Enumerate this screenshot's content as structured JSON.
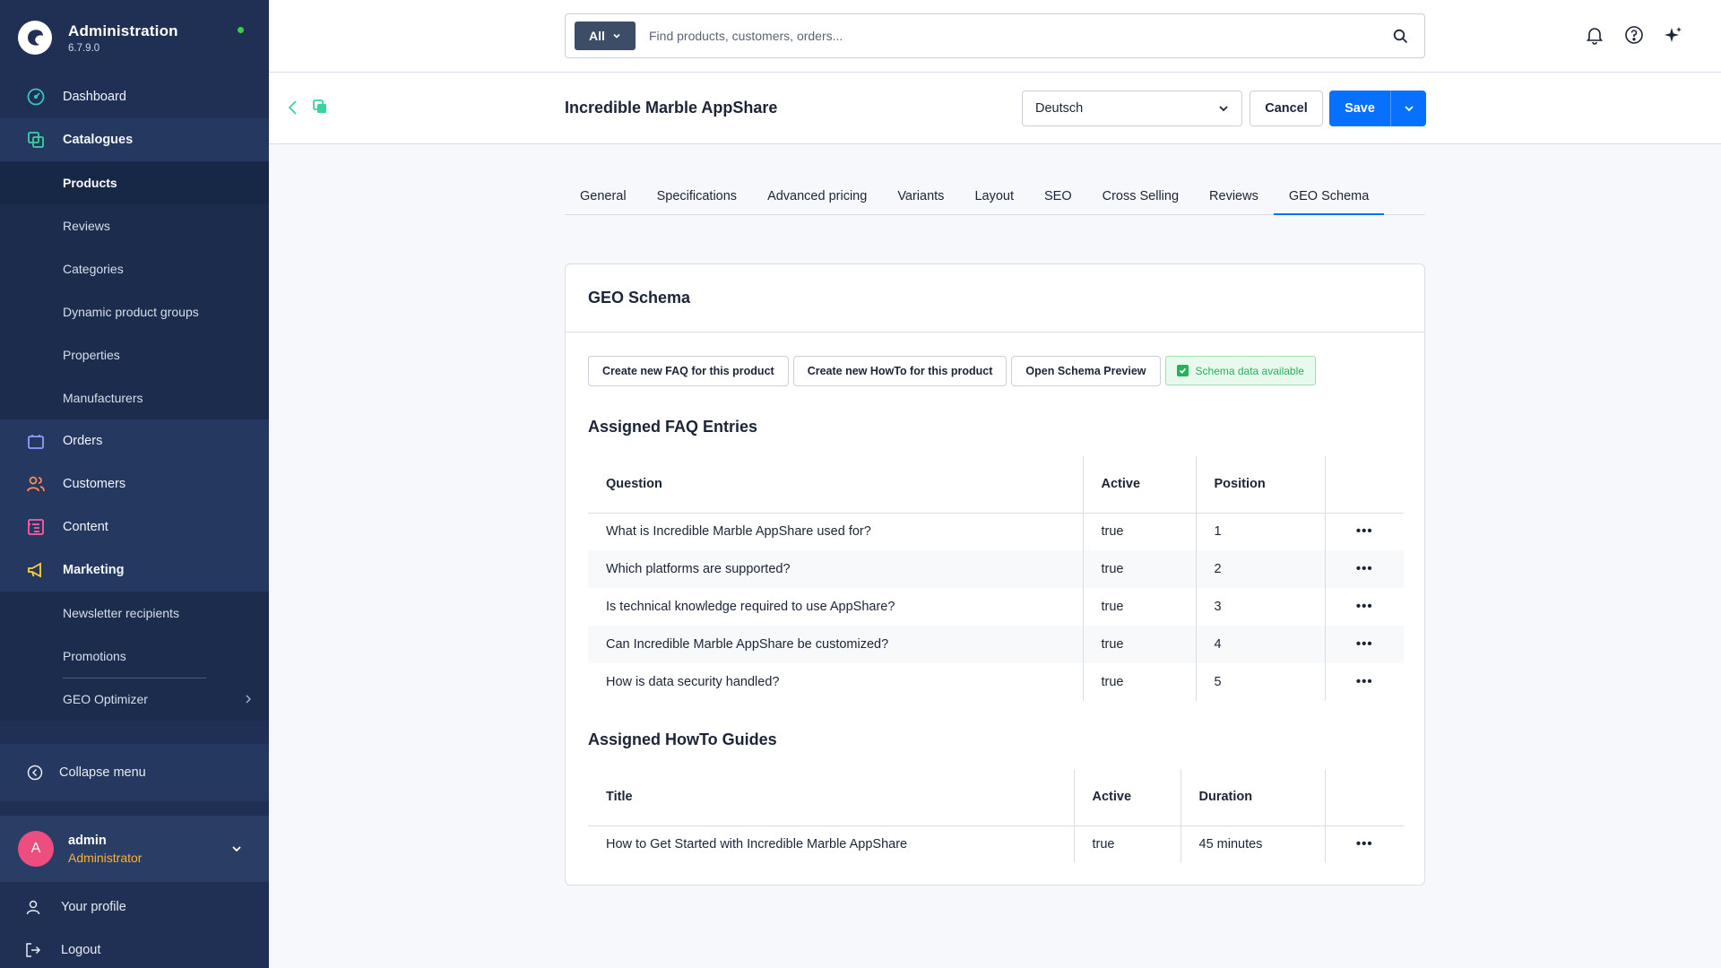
{
  "app": {
    "title": "Administration",
    "version": "6.7.9.0",
    "status_color": "#37d046"
  },
  "sidebar": {
    "items": [
      {
        "label": "Dashboard",
        "icon": "dashboard-gauge-icon",
        "color": "#3ac4c4"
      },
      {
        "label": "Catalogues",
        "icon": "catalogue-stack-icon",
        "color": "#3ed0a0"
      },
      {
        "label": "Orders",
        "icon": "shopping-bag-icon",
        "color": "#8a9fff"
      },
      {
        "label": "Customers",
        "icon": "users-icon",
        "color": "#ff8a5c"
      },
      {
        "label": "Content",
        "icon": "content-list-icon",
        "color": "#ff5ca6"
      },
      {
        "label": "Marketing",
        "icon": "megaphone-icon",
        "color": "#ffd23a"
      }
    ],
    "catalogue_children": [
      "Products",
      "Reviews",
      "Categories",
      "Dynamic product groups",
      "Properties",
      "Manufacturers"
    ],
    "marketing_children": [
      "Newsletter recipients",
      "Promotions",
      "GEO Optimizer"
    ],
    "collapse_label": "Collapse menu",
    "user": {
      "initial": "A",
      "name": "admin",
      "role": "Administrator"
    },
    "profile_label": "Your profile",
    "logout_label": "Logout"
  },
  "search": {
    "type_label": "All",
    "placeholder": "Find products, customers, orders..."
  },
  "header": {
    "title": "Incredible Marble AppShare",
    "language": "Deutsch",
    "cancel_label": "Cancel",
    "save_label": "Save",
    "accent_color": "#0870ff"
  },
  "tabs": [
    "General",
    "Specifications",
    "Advanced pricing",
    "Variants",
    "Layout",
    "SEO",
    "Cross Selling",
    "Reviews",
    "GEO Schema"
  ],
  "active_tab": "GEO Schema",
  "card": {
    "title": "GEO Schema",
    "actions": {
      "create_faq": "Create new FAQ for this product",
      "create_howto": "Create new HowTo for this product",
      "preview": "Open Schema Preview",
      "schema_status": "Schema data available"
    },
    "faq": {
      "title": "Assigned FAQ Entries",
      "columns": [
        "Question",
        "Active",
        "Position"
      ],
      "rows": [
        {
          "question": "What is Incredible Marble AppShare used for?",
          "active": "true",
          "position": "1"
        },
        {
          "question": "Which platforms are supported?",
          "active": "true",
          "position": "2"
        },
        {
          "question": "Is technical knowledge required to use AppShare?",
          "active": "true",
          "position": "3"
        },
        {
          "question": "Can Incredible Marble AppShare be customized?",
          "active": "true",
          "position": "4"
        },
        {
          "question": "How is data security handled?",
          "active": "true",
          "position": "5"
        }
      ]
    },
    "howto": {
      "title": "Assigned HowTo Guides",
      "columns": [
        "Title",
        "Active",
        "Duration"
      ],
      "rows": [
        {
          "title": "How to Get Started with Incredible Marble AppShare",
          "active": "true",
          "duration": "45 minutes"
        }
      ]
    },
    "row_menu_glyph": "•••"
  }
}
